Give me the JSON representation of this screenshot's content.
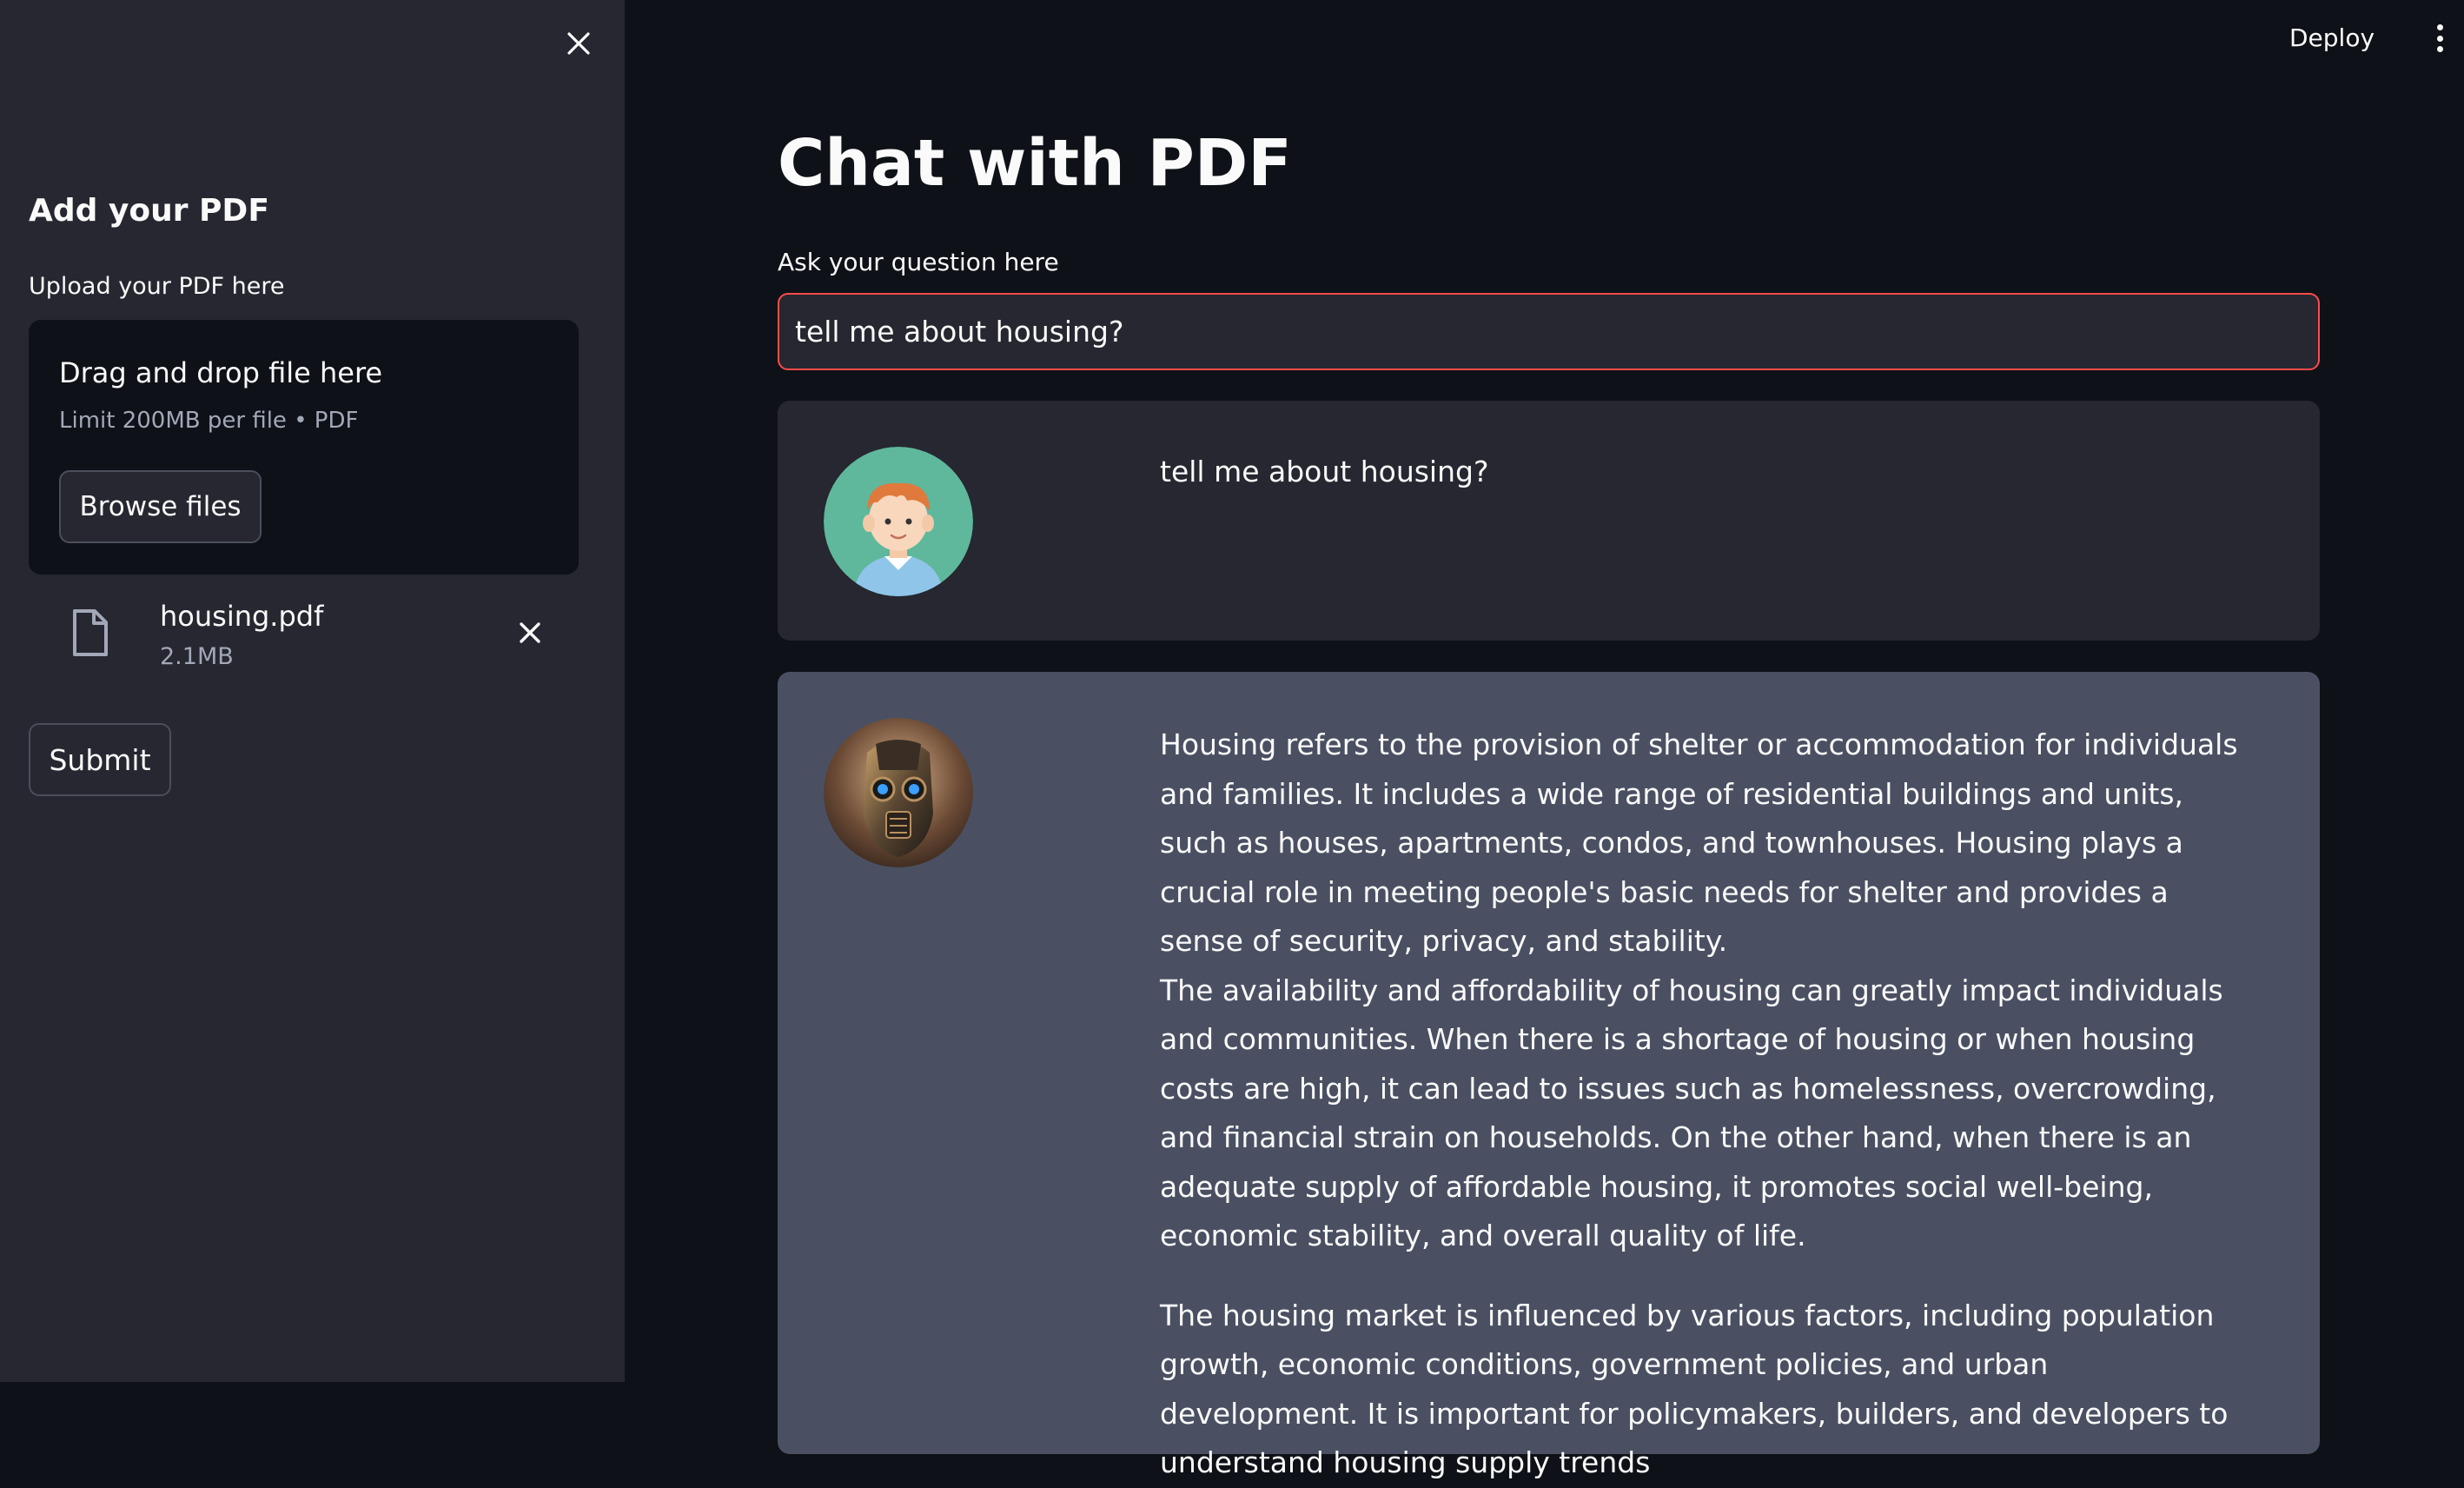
{
  "sidebar": {
    "heading": "Add your PDF",
    "upload_label": "Upload your PDF here",
    "dropzone": {
      "title": "Drag and drop file here",
      "limit": "Limit 200MB per file • PDF",
      "browse_label": "Browse files"
    },
    "file": {
      "name": "housing.pdf",
      "size": "2.1MB"
    },
    "submit_label": "Submit"
  },
  "header": {
    "deploy_label": "Deploy"
  },
  "main": {
    "title": "Chat with PDF",
    "question_label": "Ask your question here",
    "question_value": "tell me about housing?",
    "messages": [
      {
        "role": "user",
        "text": "tell me about housing?"
      },
      {
        "role": "bot",
        "paragraphs": [
          "Housing refers to the provision of shelter or accommodation for individuals and families. It includes a wide range of residential buildings and units, such as houses, apartments, condos, and townhouses. Housing plays a crucial role in meeting people's basic needs for shelter and provides a sense of security, privacy, and stability.",
          "The availability and affordability of housing can greatly impact individuals and communities. When there is a shortage of housing or when housing costs are high, it can lead to issues such as homelessness, overcrowding, and financial strain on households. On the other hand, when there is an adequate supply of affordable housing, it promotes social well-being, economic stability, and overall quality of life.",
          "The housing market is influenced by various factors, including population growth, economic conditions, government policies, and urban development. It is important for policymakers, builders, and developers to understand housing supply trends"
        ]
      }
    ]
  },
  "colors": {
    "background": "#0e1117",
    "sidebar": "#262730",
    "accent_border": "#ff4b4b",
    "bot_message_bg": "#4a5062",
    "user_avatar_bg": "#5fb89b"
  },
  "icons": {
    "sidebar_close": "close-icon",
    "file": "file-icon",
    "file_remove": "close-icon",
    "menu": "kebab-menu-icon"
  }
}
